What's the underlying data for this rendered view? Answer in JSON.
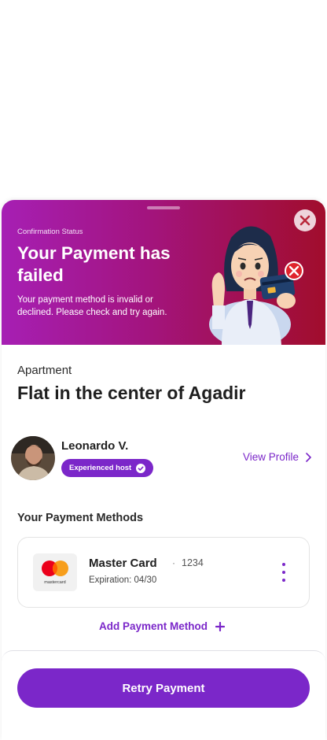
{
  "banner": {
    "label": "Confirmation Status",
    "title": "Your Payment has failed",
    "description": "Your payment method is invalid or declined. Please check and try again.",
    "close_icon": "close-icon",
    "illustration": "woman-declined-card-illustration",
    "gradient": [
      "#a61fb4",
      "#a3147e",
      "#a10d2c"
    ]
  },
  "listing": {
    "type": "Apartment",
    "name": "Flat in the center of Agadir"
  },
  "host": {
    "name": "Leonardo V.",
    "badge": "Experienced host",
    "view_profile": "View Profile"
  },
  "payment": {
    "section_title": "Your Payment Methods",
    "card": {
      "name": "Master Card",
      "separator": "·",
      "last4": "1234",
      "expiration": "Expiration: 04/30",
      "logo_text": "mastercard"
    },
    "add_label": "Add Payment Method"
  },
  "footer": {
    "retry_label": "Retry Payment"
  },
  "colors": {
    "accent": "#7b27c9",
    "error": "#e0242c"
  }
}
